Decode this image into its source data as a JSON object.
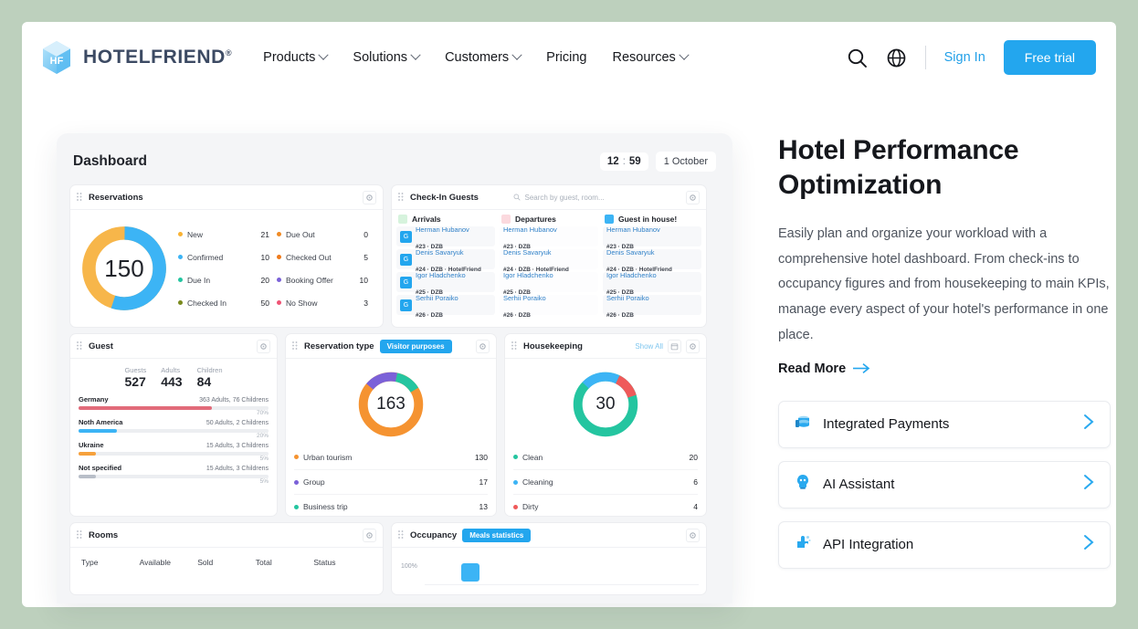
{
  "nav": {
    "brand": "HOTELFRIEND",
    "brand_tm": "®",
    "links": [
      {
        "label": "Products",
        "has_caret": true
      },
      {
        "label": "Solutions",
        "has_caret": true
      },
      {
        "label": "Customers",
        "has_caret": true
      },
      {
        "label": "Pricing",
        "has_caret": false
      },
      {
        "label": "Resources",
        "has_caret": true
      }
    ],
    "search_icon": "search-icon",
    "globe_icon": "globe-icon",
    "signin": "Sign In",
    "free_trial": "Free trial",
    "accent": "#23a6ee"
  },
  "dashboard": {
    "title": "Dashboard",
    "clock_hours": "12",
    "clock_sep": ":",
    "clock_minutes": "59",
    "date": "1 October",
    "reservations": {
      "title": "Reservations",
      "total": "150",
      "legend_left": [
        {
          "label": "New",
          "value": "21",
          "color": "#f9b233"
        },
        {
          "label": "Confirmed",
          "value": "10",
          "color": "#3cb4f5"
        },
        {
          "label": "Due In",
          "value": "20",
          "color": "#24c5a0"
        },
        {
          "label": "Checked In",
          "value": "50",
          "color": "#7a8a1e"
        }
      ],
      "legend_right": [
        {
          "label": "Due Out",
          "value": "0",
          "color": "#f08a24"
        },
        {
          "label": "Checked Out",
          "value": "5",
          "color": "#ef7a1b"
        },
        {
          "label": "Booking Offer",
          "value": "10",
          "color": "#7b61d8"
        },
        {
          "label": "No Show",
          "value": "3",
          "color": "#ef5374"
        }
      ]
    },
    "checkin": {
      "title": "Check-In Guests",
      "search_placeholder": "Search by guest, room...",
      "columns": [
        {
          "label": "Arrivals",
          "color": "#d6f3dd",
          "highlight": true,
          "guests": [
            {
              "name": "Herman Hubanov",
              "sub": "#23 · DZB"
            },
            {
              "name": "Denis Savaryuk",
              "sub": "#24 · DZB · HotelFriend"
            },
            {
              "name": "Igor Hladchenko",
              "sub": "#25 · DZB"
            },
            {
              "name": "Serhii Poraiko",
              "sub": "#26 · DZB"
            }
          ]
        },
        {
          "label": "Departures",
          "color": "#fbd9de",
          "highlight": false,
          "guests": [
            {
              "name": "Herman Hubanov",
              "sub": "#23 · DZB"
            },
            {
              "name": "Denis Savaryuk",
              "sub": "#24 · DZB · HotelFriend"
            },
            {
              "name": "Igor Hladchenko",
              "sub": "#25 · DZB"
            },
            {
              "name": "Serhii Poraiko",
              "sub": "#26 · DZB"
            }
          ]
        },
        {
          "label": "Guest in house!",
          "color": "#3cb4f5",
          "highlight": false,
          "guests": [
            {
              "name": "Herman Hubanov",
              "sub": "#23 · DZB"
            },
            {
              "name": "Denis Savaryuk",
              "sub": "#24 · DZB · HotelFriend"
            },
            {
              "name": "Igor Hladchenko",
              "sub": "#25 · DZB"
            },
            {
              "name": "Serhii Poraiko",
              "sub": "#26 · DZB"
            }
          ]
        }
      ]
    },
    "guest": {
      "title": "Guest",
      "stats": [
        {
          "label": "Guests",
          "value": "527"
        },
        {
          "label": "Adults",
          "value": "443"
        },
        {
          "label": "Children",
          "value": "84"
        }
      ],
      "rows": [
        {
          "name": "Germany",
          "detail": "363 Adults, 76 Childrens",
          "pct": "70%",
          "pct_num": 70,
          "color": "#e26b7a"
        },
        {
          "name": "Noth America",
          "detail": "50 Adults, 2 Childrens",
          "pct": "20%",
          "pct_num": 20,
          "color": "#3cb4f5"
        },
        {
          "name": "Ukraine",
          "detail": "15 Adults, 3 Childrens",
          "pct": "5%",
          "pct_num": 9,
          "color": "#f6a13c"
        },
        {
          "name": "Not specified",
          "detail": "15 Adults, 3 Childrens",
          "pct": "5%",
          "pct_num": 9,
          "color": "#b8bec8"
        }
      ]
    },
    "restype": {
      "title": "Reservation type",
      "badge": "Visitor purposes",
      "total": "163",
      "legend": [
        {
          "label": "Urban tourism",
          "value": "130",
          "color": "#f59331"
        },
        {
          "label": "Group",
          "value": "17",
          "color": "#7b61d8"
        },
        {
          "label": "Business trip",
          "value": "13",
          "color": "#24c5a0"
        }
      ]
    },
    "housekeeping": {
      "title": "Housekeeping",
      "show_all": "Show All",
      "total": "30",
      "legend": [
        {
          "label": "Clean",
          "value": "20",
          "color": "#24c5a0"
        },
        {
          "label": "Cleaning",
          "value": "6",
          "color": "#3cb4f5"
        },
        {
          "label": "Dirty",
          "value": "4",
          "color": "#ef5a5a"
        }
      ]
    },
    "rooms": {
      "title": "Rooms",
      "headers": [
        "Type",
        "Available",
        "Sold",
        "Total",
        "Status"
      ]
    },
    "occupancy": {
      "title": "Occupancy",
      "badge": "Meals statistics",
      "axis_label": "100%"
    }
  },
  "hero": {
    "title": "Hotel Performance Optimization",
    "body": "Easily plan and organize your workload with a comprehensive hotel dashboard. From check-ins to occupancy figures and from housekeeping to main KPIs, manage every aspect of your hotel's performance in one place.",
    "read_more": "Read More",
    "features": [
      {
        "label": "Integrated Payments",
        "icon": "payments-icon"
      },
      {
        "label": "AI Assistant",
        "icon": "ai-assistant-icon"
      },
      {
        "label": "API Integration",
        "icon": "api-integration-icon"
      }
    ]
  },
  "chart_data": [
    {
      "type": "pie",
      "title": "Reservations",
      "center_label": "150",
      "labels": [
        "New",
        "Confirmed",
        "Due In",
        "Checked In",
        "Due Out",
        "Checked Out",
        "Booking Offer",
        "No Show"
      ],
      "values": [
        21,
        10,
        20,
        50,
        0,
        5,
        10,
        3
      ],
      "colors": [
        "#f9b233",
        "#3cb4f5",
        "#24c5a0",
        "#7a8a1e",
        "#f08a24",
        "#ef7a1b",
        "#7b61d8",
        "#ef5374"
      ],
      "rendered_segments": [
        {
          "label": "Confirmed",
          "color": "#3cb4f5",
          "fraction": 0.55
        },
        {
          "label": "New",
          "color": "#f7b64a",
          "fraction": 0.45
        }
      ],
      "legend": "right"
    },
    {
      "type": "bar",
      "title": "Guest",
      "categories": [
        "Germany",
        "Noth America",
        "Ukraine",
        "Not specified"
      ],
      "values": [
        70,
        20,
        5,
        5
      ],
      "ylabel": "%",
      "ylim": [
        0,
        100
      ],
      "colors": [
        "#e26b7a",
        "#3cb4f5",
        "#f6a13c",
        "#b8bec8"
      ],
      "orientation": "horizontal"
    },
    {
      "type": "pie",
      "title": "Reservation type",
      "center_label": "163",
      "labels": [
        "Urban tourism",
        "Group",
        "Business trip"
      ],
      "values": [
        130,
        17,
        13
      ],
      "colors": [
        "#f59331",
        "#7b61d8",
        "#24c5a0"
      ],
      "legend": "bottom"
    },
    {
      "type": "pie",
      "title": "Housekeeping",
      "center_label": "30",
      "labels": [
        "Clean",
        "Cleaning",
        "Dirty"
      ],
      "values": [
        20,
        6,
        4
      ],
      "colors": [
        "#24c5a0",
        "#3cb4f5",
        "#ef5a5a"
      ],
      "legend": "bottom"
    },
    {
      "type": "bar",
      "title": "Occupancy",
      "categories": [
        ""
      ],
      "values": [
        100
      ],
      "ylabel": "100%",
      "ylim": [
        0,
        100
      ],
      "colors": [
        "#3cb4f5"
      ]
    }
  ]
}
